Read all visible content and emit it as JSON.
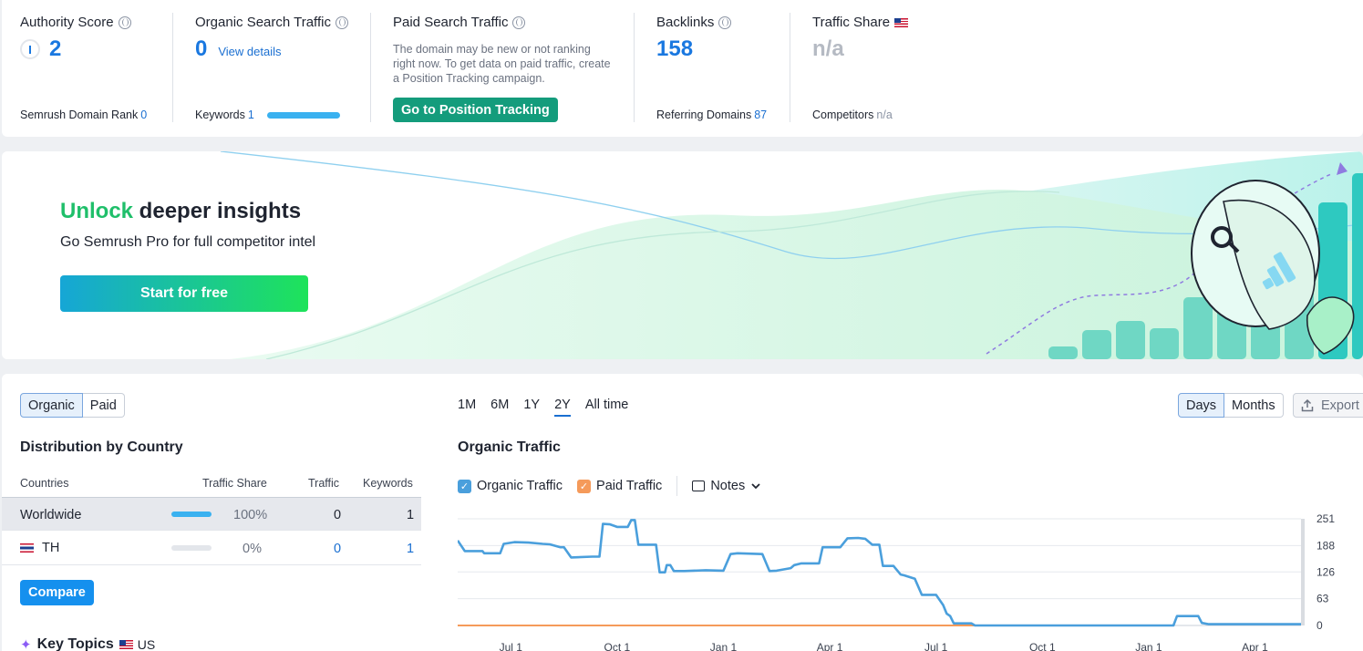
{
  "metrics": {
    "authority": {
      "title": "Authority Score",
      "value": "2",
      "foot_label": "Semrush Domain Rank",
      "foot_value": "0"
    },
    "organic": {
      "title": "Organic Search Traffic",
      "value": "0",
      "link": "View details",
      "foot_label": "Keywords",
      "foot_value": "1"
    },
    "paid": {
      "title": "Paid Search Traffic",
      "description": "The domain may be new or not ranking right now. To get data on paid traffic, create a Position Tracking campaign.",
      "button": "Go to Position Tracking"
    },
    "backlinks": {
      "title": "Backlinks",
      "value": "158",
      "foot_label": "Referring Domains",
      "foot_value": "87"
    },
    "share": {
      "title": "Traffic Share",
      "value": "n/a",
      "foot_label": "Competitors",
      "foot_value": "n/a"
    }
  },
  "banner": {
    "headline_highlight": "Unlock",
    "headline_rest": " deeper insights",
    "subtitle": "Go Semrush Pro for full competitor intel",
    "cta": "Start for free"
  },
  "distribution": {
    "toggle": [
      "Organic",
      "Paid"
    ],
    "title": "Distribution by Country",
    "columns": [
      "Countries",
      "Traffic Share",
      "Traffic",
      "Keywords"
    ],
    "rows": [
      {
        "country": "Worldwide",
        "share": "100%",
        "share_fraction": 1.0,
        "traffic": "0",
        "keywords": "1"
      },
      {
        "country": "TH",
        "share": "0%",
        "share_fraction": 0.0,
        "traffic": "0",
        "keywords": "1"
      }
    ],
    "compare_button": "Compare",
    "key_topics": "Key Topics",
    "key_topics_country": "US"
  },
  "chart_panel": {
    "ranges": [
      "1M",
      "6M",
      "1Y",
      "2Y",
      "All time"
    ],
    "selected_range": "2Y",
    "granularity": [
      "Days",
      "Months"
    ],
    "export": "Export",
    "title": "Organic Traffic",
    "legend": {
      "organic": "Organic Traffic",
      "paid": "Paid Traffic",
      "notes": "Notes"
    },
    "colors": {
      "organic": "#4a9fdc",
      "paid": "#f59a5a",
      "accent": "#1a6fd1"
    }
  },
  "chart_data": {
    "type": "line",
    "title": "Organic Traffic",
    "x_ticks": [
      "Jul 1",
      "Oct 1",
      "Jan 1",
      "Apr 1",
      "Jul 1",
      "Oct 1",
      "Jan 1",
      "Apr 1"
    ],
    "y_ticks": [
      0,
      63,
      126,
      188,
      251
    ],
    "ylim": [
      0,
      251
    ],
    "x_range_months": [
      0,
      23.8
    ],
    "grid": true,
    "series": [
      {
        "name": "Organic Traffic",
        "points": [
          [
            0,
            200
          ],
          [
            0.2,
            175
          ],
          [
            0.7,
            175
          ],
          [
            0.75,
            170
          ],
          [
            1.2,
            170
          ],
          [
            1.3,
            192
          ],
          [
            1.6,
            196
          ],
          [
            2.0,
            195
          ],
          [
            2.4,
            192
          ],
          [
            2.6,
            191
          ],
          [
            2.9,
            184
          ],
          [
            3.0,
            184
          ],
          [
            3.2,
            160
          ],
          [
            3.8,
            162
          ],
          [
            4.0,
            162
          ],
          [
            4.1,
            239
          ],
          [
            4.3,
            238
          ],
          [
            4.5,
            232
          ],
          [
            4.8,
            232
          ],
          [
            4.9,
            248
          ],
          [
            5.0,
            248
          ],
          [
            5.1,
            190
          ],
          [
            5.6,
            190
          ],
          [
            5.7,
            125
          ],
          [
            5.85,
            125
          ],
          [
            5.9,
            142
          ],
          [
            6.0,
            142
          ],
          [
            6.1,
            128
          ],
          [
            6.3,
            128
          ],
          [
            6.4,
            128
          ],
          [
            7.0,
            130
          ],
          [
            7.5,
            129
          ],
          [
            7.7,
            168
          ],
          [
            7.9,
            170
          ],
          [
            8.6,
            168
          ],
          [
            8.8,
            128
          ],
          [
            9.0,
            129
          ],
          [
            9.4,
            135
          ],
          [
            9.5,
            142
          ],
          [
            9.7,
            146
          ],
          [
            10.0,
            146
          ],
          [
            10.2,
            146
          ],
          [
            10.3,
            184
          ],
          [
            10.8,
            184
          ],
          [
            11.0,
            205
          ],
          [
            11.3,
            206
          ],
          [
            11.5,
            204
          ],
          [
            11.7,
            190
          ],
          [
            11.9,
            190
          ],
          [
            12.0,
            140
          ],
          [
            12.3,
            140
          ],
          [
            12.5,
            120
          ],
          [
            12.6,
            118
          ],
          [
            12.9,
            110
          ],
          [
            13.1,
            72
          ],
          [
            13.5,
            72
          ],
          [
            13.7,
            48
          ],
          [
            13.8,
            28
          ],
          [
            13.9,
            22
          ],
          [
            14.0,
            5
          ],
          [
            14.5,
            5
          ],
          [
            14.6,
            0
          ],
          [
            20.2,
            0
          ],
          [
            20.3,
            22
          ],
          [
            20.5,
            22
          ],
          [
            20.9,
            22
          ],
          [
            21.0,
            6
          ],
          [
            21.2,
            3
          ],
          [
            23.8,
            3
          ]
        ]
      },
      {
        "name": "Paid Traffic",
        "points": [
          [
            0,
            0
          ],
          [
            14.6,
            0
          ]
        ]
      }
    ]
  }
}
